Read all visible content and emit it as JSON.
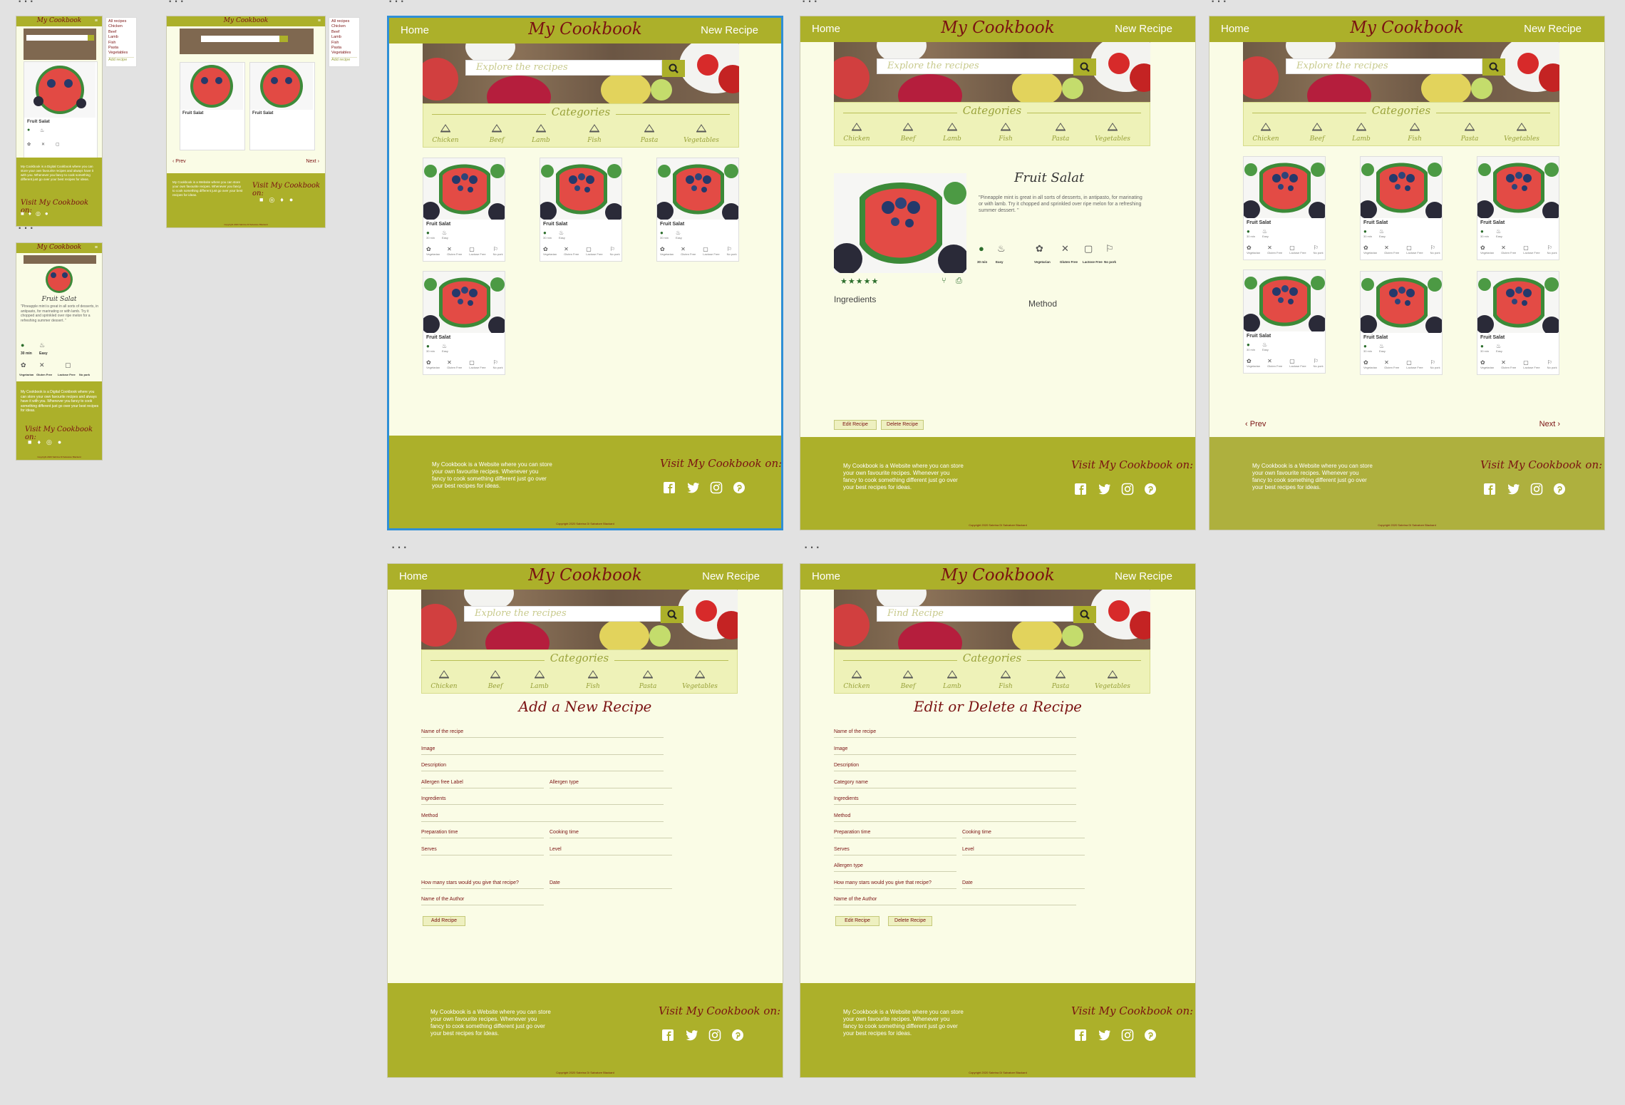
{
  "brand": "My Cookbook",
  "nav": {
    "home": "Home",
    "new_recipe": "New Recipe"
  },
  "search": {
    "placeholder_explore": "Explore the recipes",
    "placeholder_find": "Find Recipe"
  },
  "categories": {
    "title": "Categories",
    "items": [
      "Chicken",
      "Beef",
      "Lamb",
      "Fish",
      "Pasta",
      "Vegetables"
    ]
  },
  "dropdown": {
    "items": [
      "All recipes",
      "Chicken",
      "Beef",
      "Lamb",
      "Fish",
      "Pasta",
      "Vegetables"
    ],
    "add": "Add recipe"
  },
  "card": {
    "title": "Fruit Salat",
    "time": "30 min",
    "level": "Easy",
    "tags": [
      "Vegetarian",
      "Gluten Free",
      "Lactose Free",
      "No pork"
    ]
  },
  "detail": {
    "title": "Fruit Salat",
    "quote": "\"Pineapple mint is great in all sorts of desserts, in antipasto, for marinating or with lamb. Try it chopped and sprinkled over ripe melon for a refreshing summer dessert. \"",
    "quote_mobile": "\"Pineapple mint is great in all sorts of desserts, in antipasto, for marinating or with lamb. Try it chopped and sprinkled over ripe melon for a refreshing summer dessert. \"",
    "time": "30 min",
    "level": "Easy",
    "tags": [
      "Vegetarian",
      "Gluten Free",
      "Lactose Free",
      "No pork"
    ],
    "stars": "★★★★★",
    "ingredients_label": "Ingredients",
    "method_label": "Method",
    "edit_btn": "Edit Recipe",
    "delete_btn": "Delete Recipe"
  },
  "pager": {
    "prev": "Prev",
    "next": "Next"
  },
  "add_form": {
    "title": "Add a New Recipe",
    "fields": {
      "name": "Name of the recipe",
      "image": "Image",
      "description": "Description",
      "allergen_free": "Allergen free Label",
      "allergen_type": "Allergen type",
      "ingredients": "Ingredients",
      "method": "Method",
      "prep": "Preparation time",
      "cook": "Cooking time",
      "serves": "Serves",
      "level": "Level",
      "stars": "How many stars would you give that recipe?",
      "date": "Date",
      "author": "Name of the Author"
    },
    "submit": "Add Recipe"
  },
  "edit_form": {
    "title": "Edit or Delete a Recipe",
    "fields": {
      "name": "Name of the recipe",
      "image": "Image",
      "description": "Description",
      "category": "Category name",
      "ingredients": "Ingredients",
      "method": "Method",
      "prep": "Preparation time",
      "cook": "Cooking time",
      "serves": "Serves",
      "level": "Level",
      "allergen_type": "Allergen type",
      "stars": "How many stars would you give that recipe?",
      "date": "Date",
      "author": "Name of the Author"
    },
    "edit_btn": "Edit Recipe",
    "delete_btn": "Delete Recipe"
  },
  "footer": {
    "about": "My Cookbook is a  Website where you can store your own favourite recipes. Whenever you fancy to cook something different just go over your best recipes for ideas.",
    "about_mobile": "My Cookbook is a  Digital Cookbook where you can store your own favourite recipes and always have it with you. Whenever you fancy to cook something different just go over your best recipes for ideas.",
    "visit": "Visit My Cookbook on:",
    "copyright": "Copyright 2020 Sabrina Di Salvatore Blackard"
  },
  "colors": {
    "olive": "#acb02a",
    "cream": "#fafce6",
    "maroon": "#7a1212",
    "selection": "#2f8fd6"
  }
}
